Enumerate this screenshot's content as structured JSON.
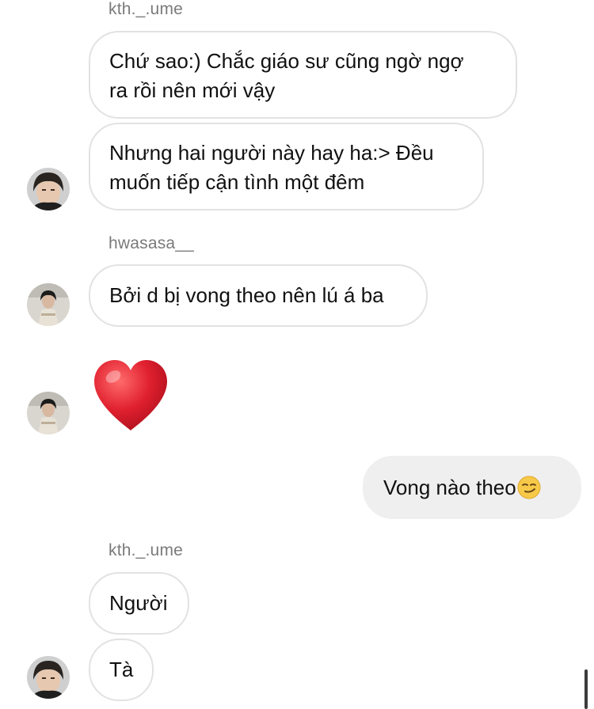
{
  "messages": [
    {
      "sender": "kth._.ume",
      "lines": [
        "Chứ sao:) Chắc giáo sư cũng ngờ ngợ",
        "ra rồi nên mới vậy"
      ]
    },
    {
      "lines": [
        "Nhưng hai người này hay ha:> Đều",
        "muốn tiếp cận tình một đêm"
      ]
    },
    {
      "sender": "hwasasa__",
      "text": "Bởi d bị vong theo nên lú á ba"
    },
    {
      "reaction": "heart"
    },
    {
      "outgoing": true,
      "text": "Vong nào theo",
      "emoji": "smirking-face"
    },
    {
      "sender": "kth._.ume",
      "text": "Người"
    },
    {
      "text": "Tà"
    }
  ],
  "icons": {
    "heart": "red-heart-emoji",
    "emoji": "smirking-face-emoji",
    "avatar_kth": "avatar-kth-ume",
    "avatar_hwasasa": "avatar-hwasasa"
  },
  "colors": {
    "incoming_bubble_bg": "#ffffff",
    "incoming_bubble_border": "#e2e2e2",
    "outgoing_bubble_bg": "#efefef",
    "sender_name": "#7a7a7a",
    "heart": "#e0202f"
  }
}
